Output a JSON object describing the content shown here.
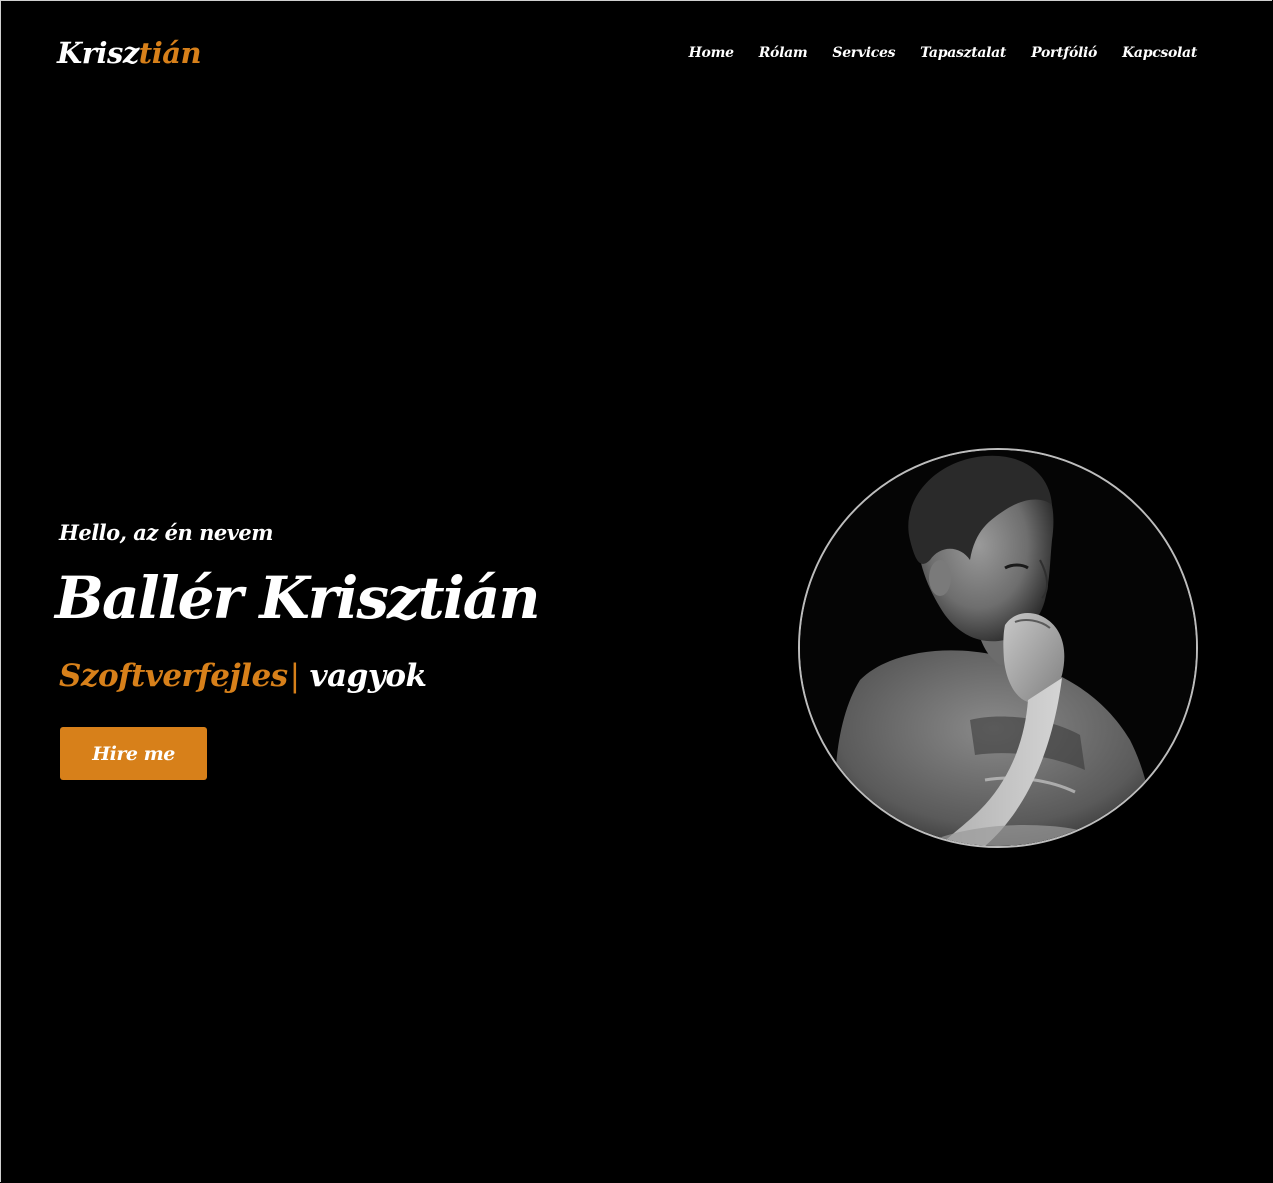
{
  "header": {
    "logo_part1": "Krisz",
    "logo_part2": "tián",
    "nav": [
      "Home",
      "Rólam",
      "Services",
      "Tapasztalat",
      "Portfólió",
      "Kapcsolat"
    ]
  },
  "hero": {
    "greeting": "Hello, az én nevem",
    "name": "Ballér Krisztián",
    "typed_text": "Szoftverfejles",
    "cursor": "|",
    "suffix": "vagyok",
    "button_label": "Hire me"
  },
  "colors": {
    "background": "#000000",
    "accent": "#d7801a",
    "text": "#ffffff"
  }
}
